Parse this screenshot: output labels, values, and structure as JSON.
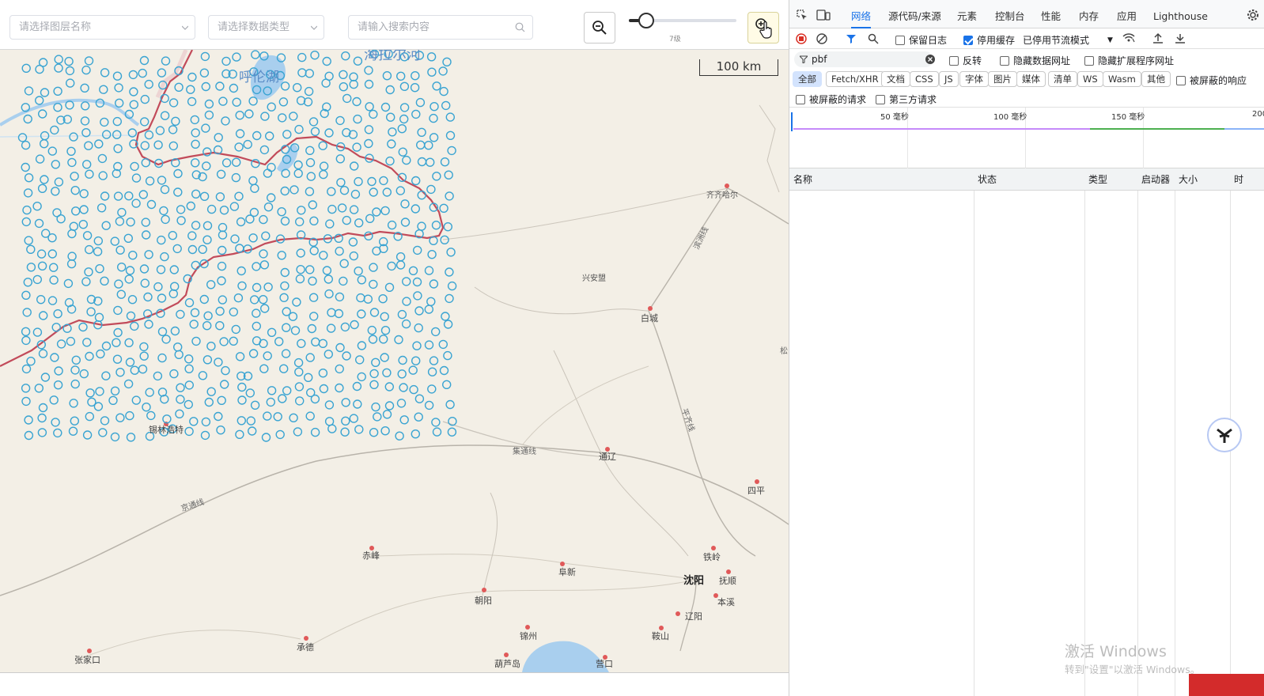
{
  "toolbar": {
    "layer_select_placeholder": "请选择图层名称",
    "data_type_placeholder": "请选择数据类型",
    "search_placeholder": "请输入搜索内容",
    "zoom_level_label": "7级",
    "zoom_slider_value": 0.16
  },
  "map": {
    "scale_label": "100 km",
    "labels": {
      "hailar": "海拉尔河",
      "hulun_lake": "呼伦湖",
      "qiqihar": "齐齐哈尔",
      "xinganmeng": "兴安盟",
      "baicheng": "白城",
      "tongliao": "通辽",
      "siping": "四平",
      "chifeng": "赤峰",
      "fuxin": "阜新",
      "chaoyang": "朝阳",
      "shenyang": "沈阳",
      "tieling": "铁岭",
      "fushun": "抚顺",
      "benxi": "本溪",
      "liaoyang": "辽阳",
      "anshan": "鞍山",
      "jinzhou": "锦州",
      "huludao": "葫芦岛",
      "yingkou": "营口",
      "chengde": "承德",
      "zhangjiakou": "张家口",
      "xilinhot": "锡林浩特",
      "jitong_line": "集通线",
      "jingtong_line": "京通线",
      "pingqi_line": "平齐线",
      "binzhou_line": "滨洲线",
      "other": "松"
    },
    "colors": {
      "marker": "#3aa4d2",
      "border": "#c24b5a",
      "water": "#a9cfee",
      "land": "#f3efe6"
    }
  },
  "devtools": {
    "tabs": [
      "网络",
      "源代码/来源",
      "元素",
      "控制台",
      "性能",
      "内存",
      "应用",
      "Lighthouse"
    ],
    "active_tab": "网络",
    "preserve_log": "保留日志",
    "disable_cache": "停用缓存",
    "throttle": "已停用节流模式",
    "filter_value": "pbf",
    "invert": "反转",
    "hide_data_urls": "隐藏数据网址",
    "hide_ext_urls": "隐藏扩展程序网址",
    "chips": [
      "全部",
      "Fetch/XHR",
      "文档",
      "CSS",
      "JS",
      "字体",
      "图片",
      "媒体",
      "清单",
      "WS",
      "Wasm",
      "其他"
    ],
    "blocked_response": "被屏蔽的响应",
    "blocked_requests": "被屏蔽的请求",
    "third_party": "第三方请求",
    "timeline_ticks": [
      "50 毫秒",
      "100 毫秒",
      "150 毫秒",
      "200"
    ],
    "columns": [
      "名称",
      "状态",
      "类型",
      "启动器",
      "大小",
      "时"
    ]
  },
  "watermark": {
    "line1": "激活 Windows",
    "line2": "转到\"设置\"以激活 Windows。"
  }
}
